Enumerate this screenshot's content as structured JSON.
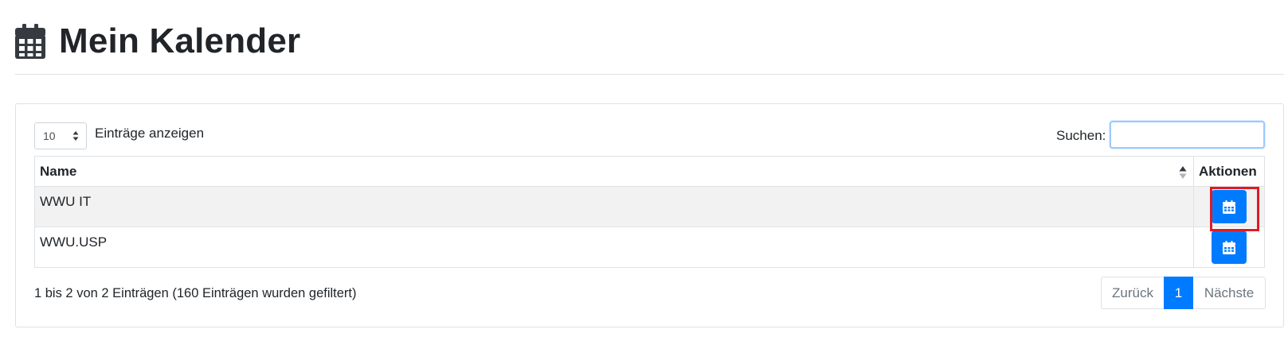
{
  "header": {
    "title": "Mein Kalender",
    "icon": "calendar-icon"
  },
  "table_controls": {
    "length_value": "10",
    "length_label": "Einträge anzeigen",
    "search_label": "Suchen:",
    "search_value": ""
  },
  "table": {
    "columns": [
      "Name",
      "Aktionen"
    ],
    "rows": [
      {
        "name": "WWU IT",
        "action_icon": "calendar-icon",
        "highlighted": true
      },
      {
        "name": "WWU.USP",
        "action_icon": "calendar-icon",
        "highlighted": false
      }
    ]
  },
  "info": "1 bis 2 von 2 Einträgen (160 Einträgen wurden gefiltert)",
  "pagination": {
    "prev": "Zurück",
    "current": "1",
    "next": "Nächste"
  },
  "colors": {
    "primary": "#007bff",
    "highlight": "#e01b24",
    "text": "#212529"
  }
}
